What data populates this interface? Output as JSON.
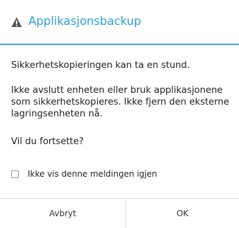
{
  "dialog": {
    "title": "Applikasjonsbackup",
    "title_icon": "warning-icon",
    "accent_color": "#2f9fd4",
    "messages": [
      "Sikkerhetskopieringen kan ta en stund.",
      "Ikke avslutt enheten eller bruk applikasjonene som sikkerhetskopieres. Ikke fjern den eksterne lagringsenheten nå.",
      "Vil du fortsette?"
    ],
    "checkbox": {
      "label": "Ikke vis denne meldingen igjen",
      "checked": false
    },
    "buttons": {
      "cancel_label": "Avbryt",
      "ok_label": "OK"
    }
  }
}
